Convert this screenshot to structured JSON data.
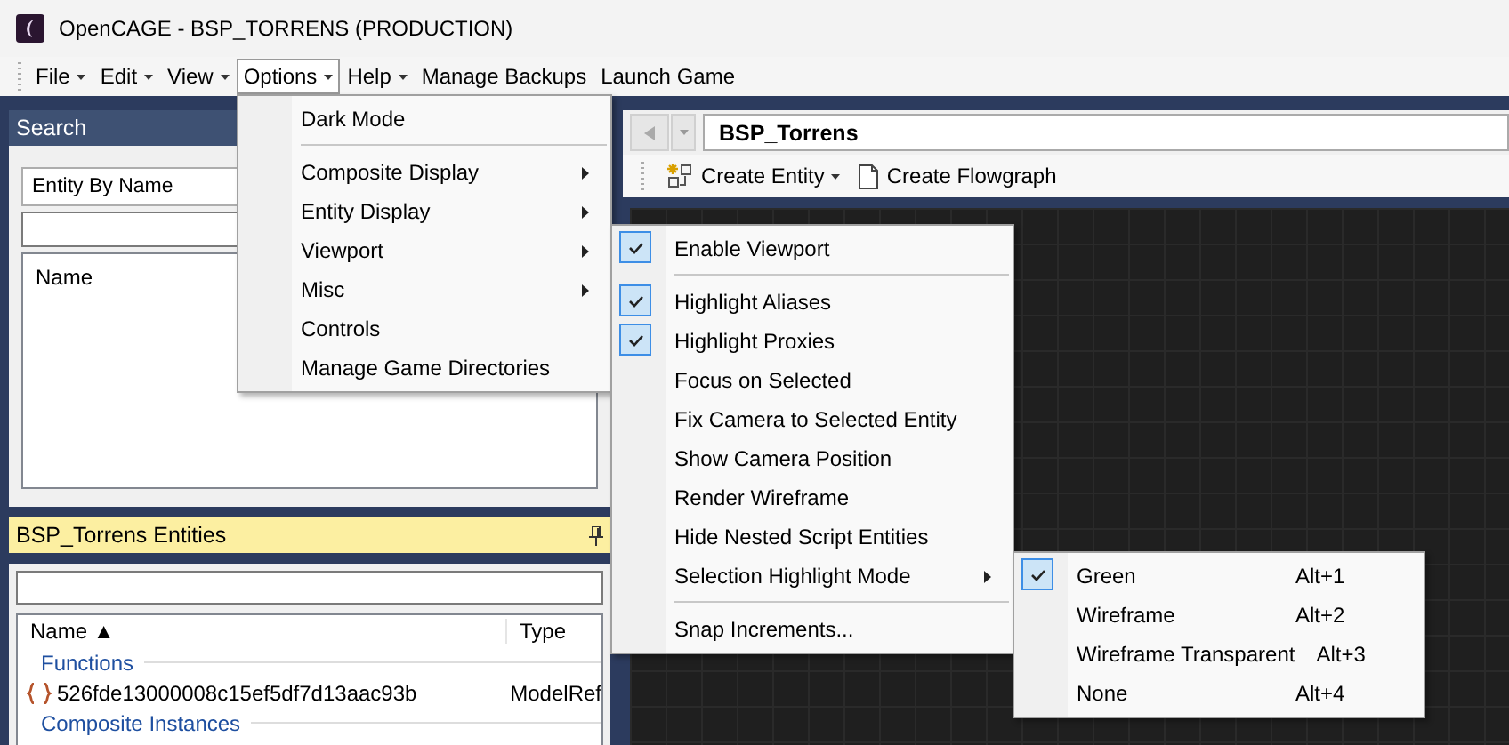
{
  "window": {
    "title": "OpenCAGE - BSP_TORRENS (PRODUCTION)"
  },
  "menu_bar": [
    {
      "label": "File",
      "has_caret": true,
      "selected": false
    },
    {
      "label": "Edit",
      "has_caret": true,
      "selected": false
    },
    {
      "label": "View",
      "has_caret": true,
      "selected": false
    },
    {
      "label": "Options",
      "has_caret": true,
      "selected": true
    },
    {
      "label": "Help",
      "has_caret": true,
      "selected": false
    },
    {
      "label": "Manage Backups",
      "has_caret": false,
      "selected": false
    },
    {
      "label": "Launch Game",
      "has_caret": false,
      "selected": false
    }
  ],
  "search_panel": {
    "title": "Search",
    "mode_dropdown": {
      "value": "Entity By Name"
    },
    "results_list": {
      "columns": [
        "Name"
      ]
    }
  },
  "entities_panel": {
    "title": "BSP_Torrens Entities",
    "columns": [
      {
        "label": "Name",
        "sort_indicator": "▲"
      },
      {
        "label": "Type"
      }
    ],
    "groups": [
      {
        "label": "Functions",
        "rows": [
          {
            "name": "526fde13000008c15ef5df7d13aac93b",
            "type": "ModelRef"
          }
        ]
      },
      {
        "label": "Composite Instances"
      }
    ]
  },
  "composite_view": {
    "path": "BSP_Torrens",
    "toolbar": [
      {
        "kind": "entity",
        "label": "Create Entity",
        "has_dropdown": true
      },
      {
        "kind": "flowgraph",
        "label": "Create Flowgraph",
        "has_dropdown": false
      }
    ]
  },
  "options_menu": {
    "items": [
      {
        "kind": "item",
        "label": "Dark Mode",
        "has_submenu": false
      },
      {
        "kind": "separator"
      },
      {
        "kind": "item",
        "label": "Composite Display",
        "has_submenu": true
      },
      {
        "kind": "item",
        "label": "Entity Display",
        "has_submenu": true
      },
      {
        "kind": "item",
        "label": "Viewport",
        "has_submenu": true
      },
      {
        "kind": "item",
        "label": "Misc",
        "has_submenu": true
      },
      {
        "kind": "item",
        "label": "Controls",
        "has_submenu": false
      },
      {
        "kind": "item",
        "label": "Manage Game Directories",
        "has_submenu": false
      }
    ]
  },
  "viewport_menu": {
    "items": [
      {
        "kind": "item",
        "label": "Enable Viewport",
        "checked": true,
        "has_submenu": false
      },
      {
        "kind": "separator"
      },
      {
        "kind": "item",
        "label": "Highlight Aliases",
        "checked": true,
        "has_submenu": false
      },
      {
        "kind": "item",
        "label": "Highlight Proxies",
        "checked": true,
        "has_submenu": false
      },
      {
        "kind": "item",
        "label": "Focus on Selected",
        "checked": false,
        "has_submenu": false
      },
      {
        "kind": "item",
        "label": "Fix Camera to Selected Entity",
        "checked": false,
        "has_submenu": false
      },
      {
        "kind": "item",
        "label": "Show Camera Position",
        "checked": false,
        "has_submenu": false
      },
      {
        "kind": "item",
        "label": "Render Wireframe",
        "checked": false,
        "has_submenu": false
      },
      {
        "kind": "item",
        "label": "Hide Nested Script Entities",
        "checked": false,
        "has_submenu": false
      },
      {
        "kind": "item",
        "label": "Selection Highlight Mode",
        "checked": false,
        "has_submenu": true
      },
      {
        "kind": "separator"
      },
      {
        "kind": "item",
        "label": "Snap Increments...",
        "checked": false,
        "has_submenu": false
      }
    ]
  },
  "highlight_menu": {
    "items": [
      {
        "kind": "item",
        "label": "Green",
        "shortcut": "Alt+1",
        "checked": true,
        "has_submenu": false
      },
      {
        "kind": "item",
        "label": "Wireframe",
        "shortcut": "Alt+2",
        "checked": false,
        "has_submenu": false
      },
      {
        "kind": "item",
        "label": "Wireframe Transparent",
        "shortcut": "Alt+3",
        "checked": false,
        "has_submenu": false
      },
      {
        "kind": "item",
        "label": "None",
        "shortcut": "Alt+4",
        "checked": false,
        "has_submenu": false
      }
    ]
  }
}
